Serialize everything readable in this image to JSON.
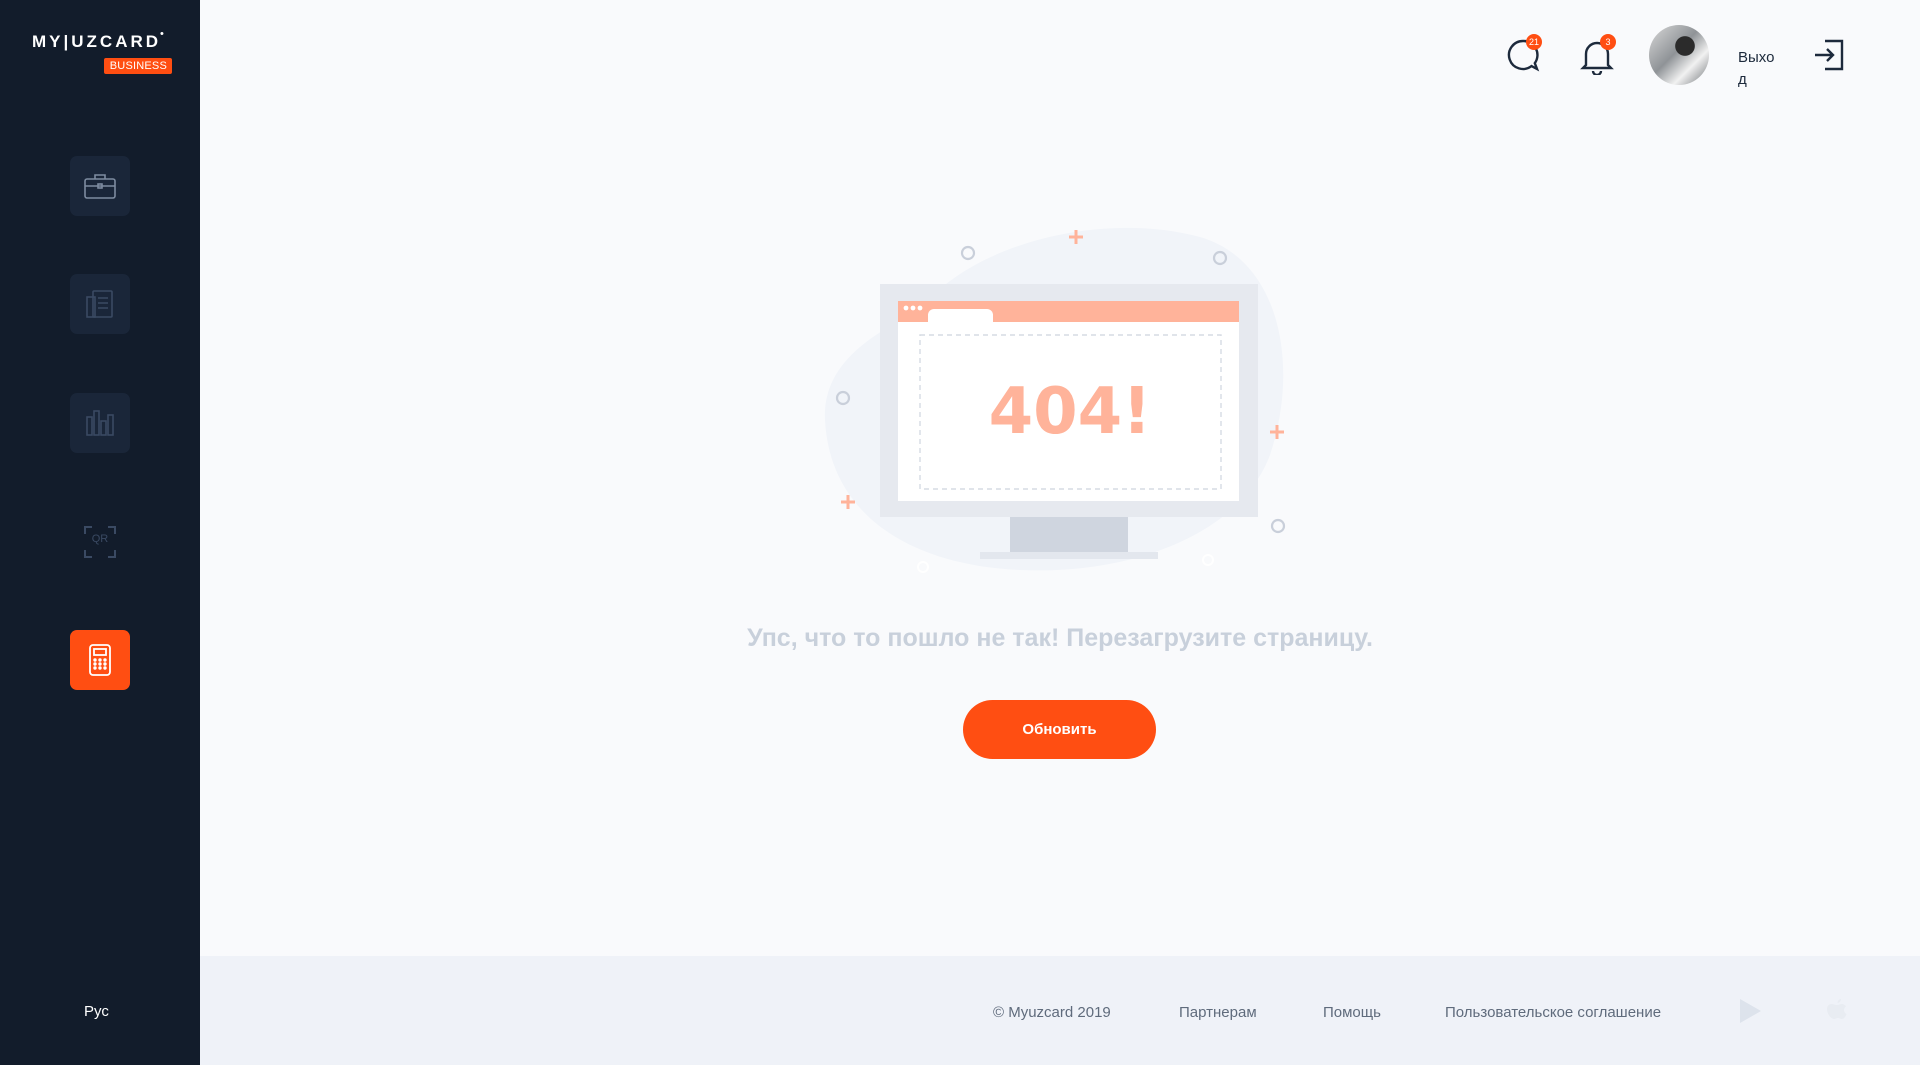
{
  "sidebar": {
    "logo": {
      "text": "MY|UZCARD",
      "badge": "BUSINESS",
      "mark": "•"
    },
    "nav": [
      {
        "icon": "briefcase-icon",
        "active": false
      },
      {
        "icon": "documents-icon",
        "active": false
      },
      {
        "icon": "bar-chart-icon",
        "active": false
      },
      {
        "icon": "qr-code-icon",
        "active": false,
        "label": "QR"
      },
      {
        "icon": "payment-terminal-icon",
        "active": true
      }
    ],
    "language": "Рус"
  },
  "header": {
    "chat_count": "21",
    "notifications_count": "3",
    "logout_label": "Выход"
  },
  "error": {
    "code": "404!",
    "message": "Упс, что то пошло не так! Перезагрузите страницу.",
    "button_label": "Обновить"
  },
  "footer": {
    "copyright": "© Myuzcard 2019",
    "links": [
      "Партнерам",
      "Помощь",
      "Пользовательское соглашение"
    ],
    "store_icons": [
      "google-play-icon",
      "apple-icon"
    ]
  },
  "colors": {
    "accent": "#ff4e12",
    "sidebar_bg": "#121c2b",
    "nav_tile_bg": "#1a2639",
    "error_peach": "#ffb39a",
    "muted_text": "#c8d0db"
  }
}
